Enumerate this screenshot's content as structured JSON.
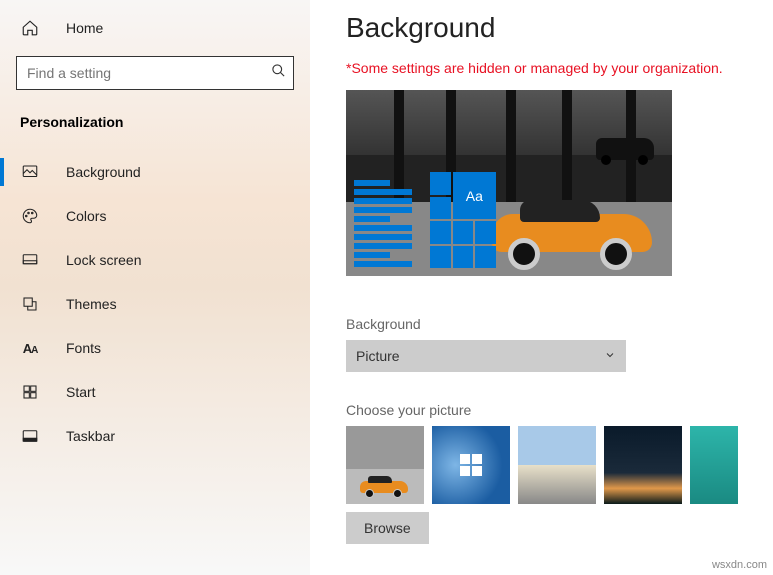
{
  "sidebar": {
    "home": "Home",
    "search_placeholder": "Find a setting",
    "section_title": "Personalization",
    "items": [
      {
        "label": "Background"
      },
      {
        "label": "Colors"
      },
      {
        "label": "Lock screen"
      },
      {
        "label": "Themes"
      },
      {
        "label": "Fonts"
      },
      {
        "label": "Start"
      },
      {
        "label": "Taskbar"
      }
    ]
  },
  "main": {
    "title": "Background",
    "warning": "*Some settings are hidden or managed by your organization.",
    "preview_sample": "Aa",
    "background_label": "Background",
    "background_value": "Picture",
    "choose_label": "Choose your picture",
    "browse_label": "Browse"
  },
  "watermark": "wsxdn.com"
}
